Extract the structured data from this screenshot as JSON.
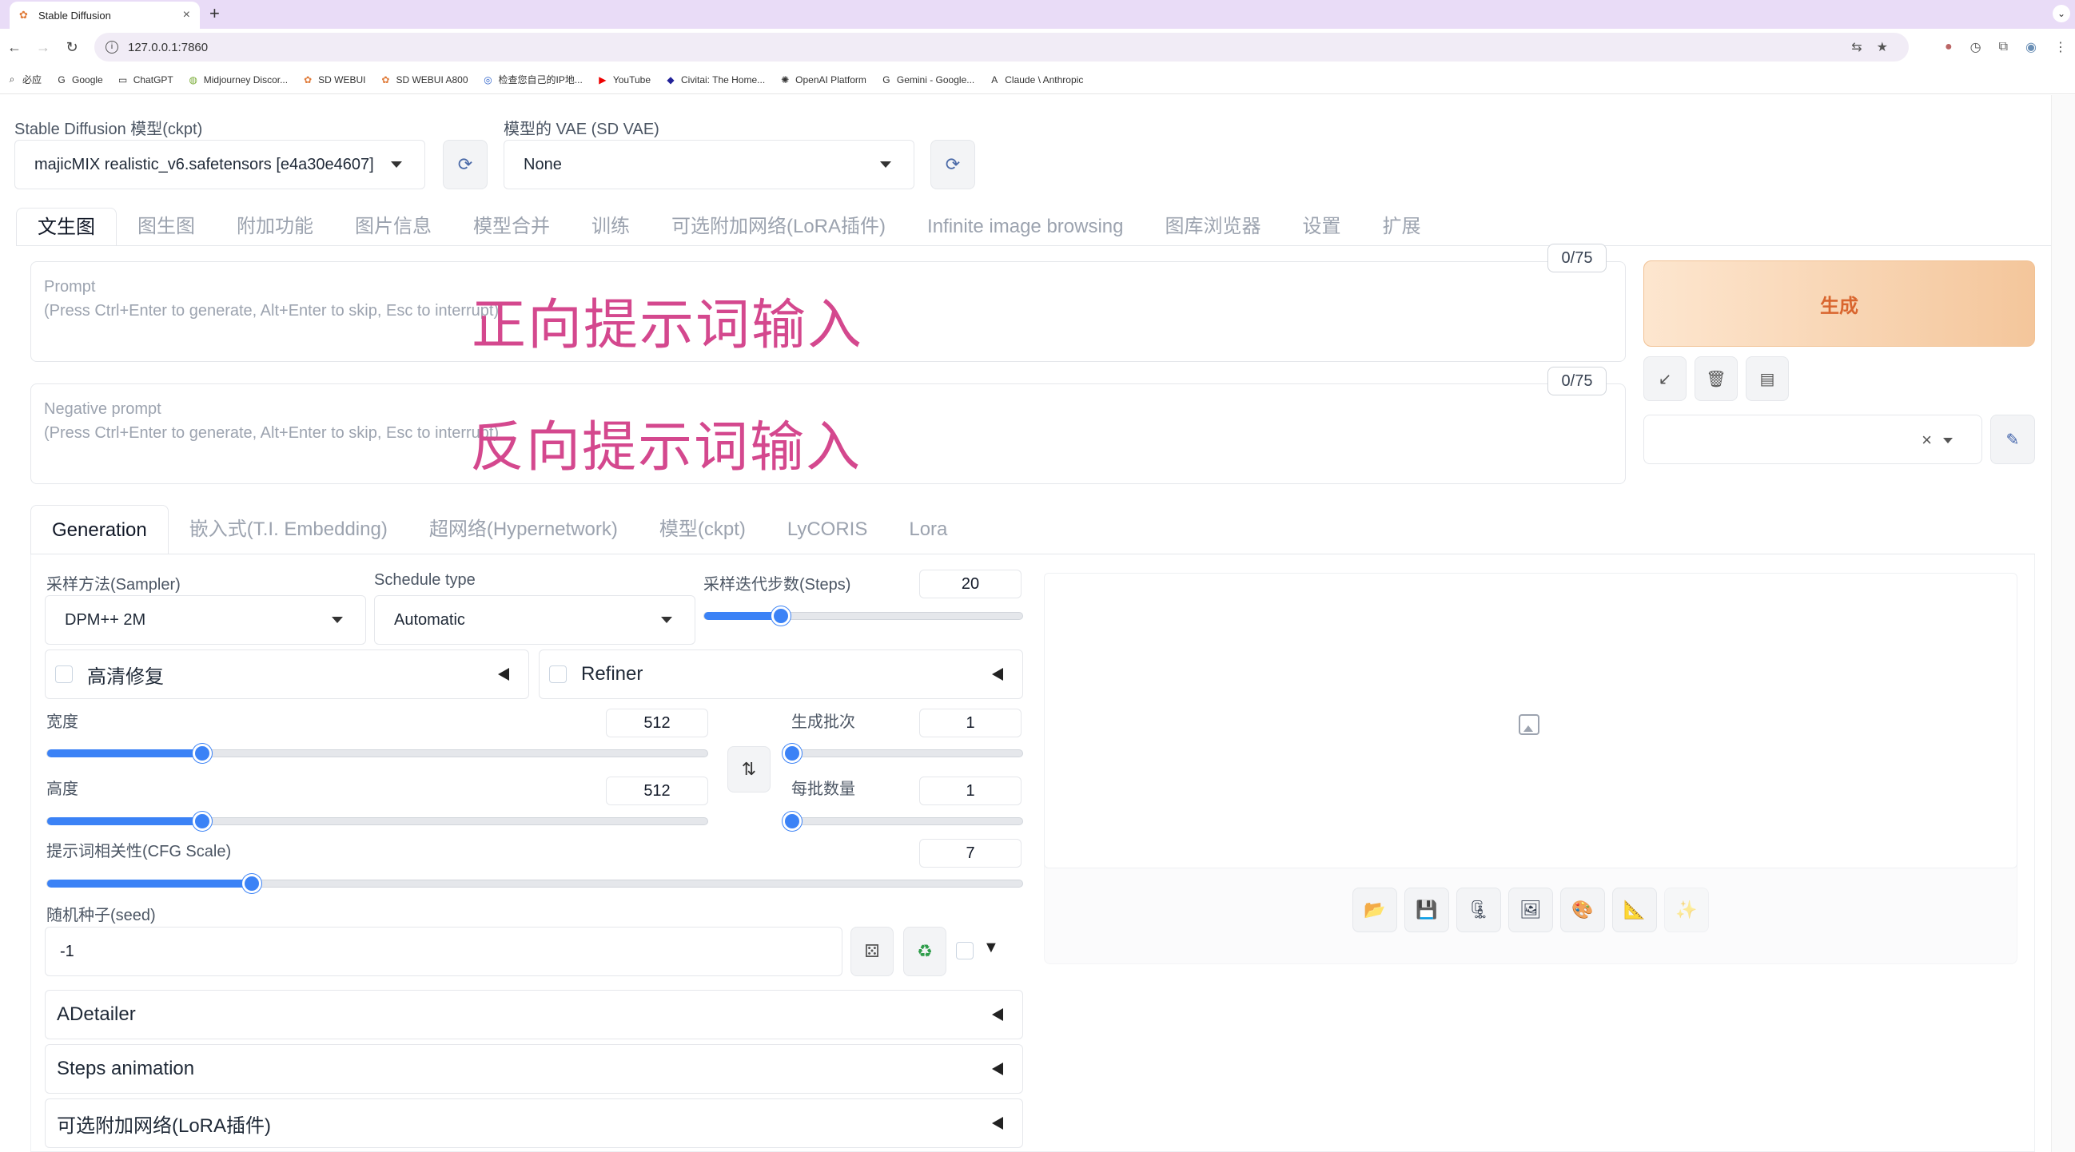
{
  "browser": {
    "tab_title": "Stable Diffusion",
    "url": "127.0.0.1:7860",
    "bookmarks": [
      "必应",
      "Google",
      "ChatGPT",
      "Midjourney Discor...",
      "SD WEBUI",
      "SD WEBUI A800",
      "检查您自己的IP地...",
      "YouTube",
      "Civitai: The Home...",
      "OpenAI Platform",
      "Gemini - Google...",
      "Claude \\ Anthropic"
    ]
  },
  "model": {
    "ckpt_label": "Stable Diffusion 模型(ckpt)",
    "ckpt_value": "majicMIX realistic_v6.safetensors [e4a30e4607]",
    "vae_label": "模型的 VAE (SD VAE)",
    "vae_value": "None"
  },
  "main_tabs": [
    "文生图",
    "图生图",
    "附加功能",
    "图片信息",
    "模型合并",
    "训练",
    "可选附加网络(LoRA插件)",
    "Infinite image browsing",
    "图库浏览器",
    "设置",
    "扩展"
  ],
  "prompt": {
    "placeholder_title": "Prompt",
    "placeholder_hint": "(Press Ctrl+Enter to generate, Alt+Enter to skip, Esc to interrupt)",
    "counter": "0/75",
    "overlay": "正向提示词输入"
  },
  "negative": {
    "placeholder_title": "Negative prompt",
    "placeholder_hint": "(Press Ctrl+Enter to generate, Alt+Enter to skip, Esc to interrupt)",
    "counter": "0/75",
    "overlay": "反向提示词输入"
  },
  "generate_label": "生成",
  "sub_tabs": [
    "Generation",
    "嵌入式(T.I. Embedding)",
    "超网络(Hypernetwork)",
    "模型(ckpt)",
    "LyCORIS",
    "Lora"
  ],
  "generation": {
    "sampler_label": "采样方法(Sampler)",
    "sampler_value": "DPM++ 2M",
    "schedule_label": "Schedule type",
    "schedule_value": "Automatic",
    "steps_label": "采样迭代步数(Steps)",
    "steps_value": "20",
    "hires_label": "高清修复",
    "refiner_label": "Refiner",
    "width_label": "宽度",
    "width_value": "512",
    "height_label": "高度",
    "height_value": "512",
    "batch_count_label": "生成批次",
    "batch_count_value": "1",
    "batch_size_label": "每批数量",
    "batch_size_value": "1",
    "cfg_label": "提示词相关性(CFG Scale)",
    "cfg_value": "7",
    "seed_label": "随机种子(seed)",
    "seed_value": "-1",
    "extra_seed_toggle": "▼"
  },
  "sliders": {
    "steps_fraction": 0.24,
    "width_fraction": 0.235,
    "height_fraction": 0.235,
    "batch_count_fraction": 0.0,
    "batch_size_fraction": 0.0,
    "cfg_fraction": 0.21
  },
  "accordions": [
    "ADetailer",
    "Steps animation",
    "可选附加网络(LoRA插件)"
  ],
  "output_buttons": [
    "open-folder-icon",
    "save-icon",
    "zip-icon",
    "send-to-img2img-icon",
    "send-to-inpaint-icon",
    "send-to-extras-icon",
    "sparkle-icon"
  ],
  "colors": {
    "accent": "#3b82f6",
    "generate_text": "#d9652e",
    "overlay_text": "#d4488e"
  }
}
